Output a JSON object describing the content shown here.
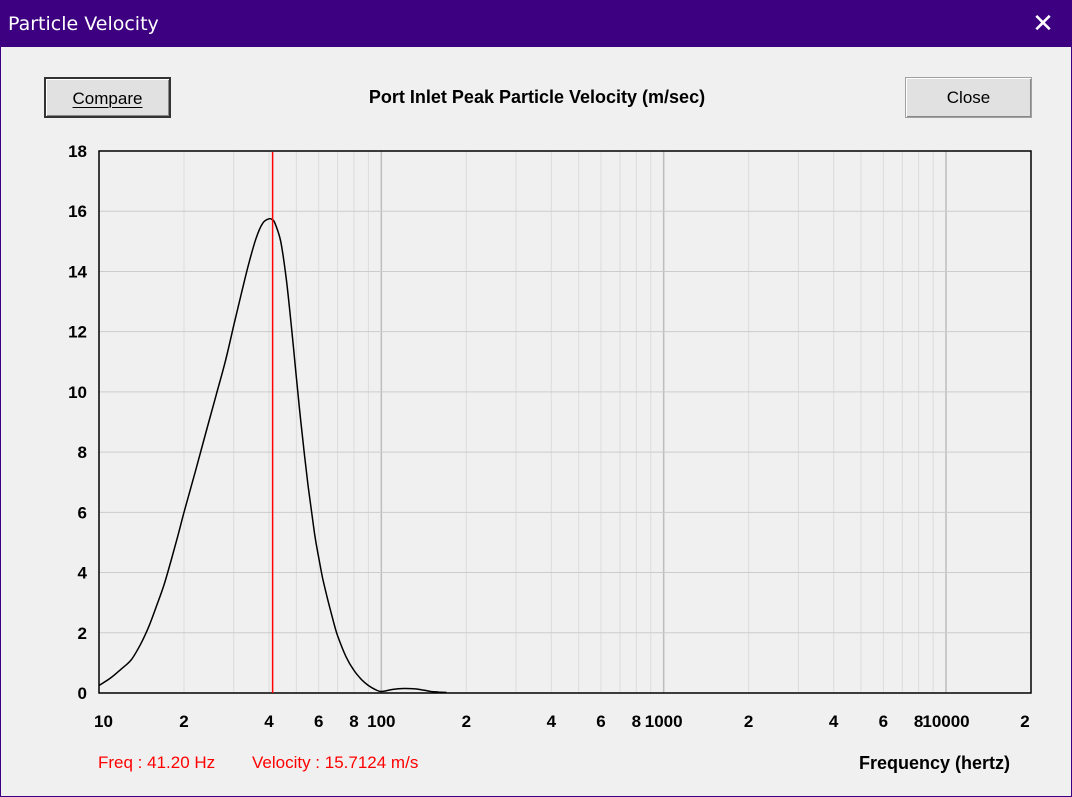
{
  "window": {
    "title": "Particle Velocity",
    "close_glyph": "✕"
  },
  "toolbar": {
    "compare_label": "Compare",
    "close_label": "Close"
  },
  "status": {
    "freq": "Freq : 41.20 Hz",
    "velocity": "Velocity : 15.7124 m/s"
  },
  "colors": {
    "titlebar": "#3d0080",
    "curve": "#000000",
    "cursor": "#ff0000",
    "grid": "#c8c8c8"
  },
  "chart_data": {
    "type": "line",
    "title": "Port Inlet Peak Particle Velocity (m/sec)",
    "xlabel": "Frequency (hertz)",
    "ylabel": "",
    "xscale": "log",
    "xlim": [
      10,
      20000
    ],
    "ylim": [
      0,
      18
    ],
    "grid": true,
    "y_ticks": [
      "0",
      "2",
      "4",
      "6",
      "8",
      "10",
      "12",
      "14",
      "16",
      "18"
    ],
    "x_ticks": [
      {
        "v": 10,
        "label": "10"
      },
      {
        "v": 20,
        "label": "2"
      },
      {
        "v": 40,
        "label": "4"
      },
      {
        "v": 60,
        "label": "6"
      },
      {
        "v": 80,
        "label": "8"
      },
      {
        "v": 100,
        "label": "100"
      },
      {
        "v": 200,
        "label": "2"
      },
      {
        "v": 400,
        "label": "4"
      },
      {
        "v": 600,
        "label": "6"
      },
      {
        "v": 800,
        "label": "8"
      },
      {
        "v": 1000,
        "label": "1000"
      },
      {
        "v": 2000,
        "label": "2"
      },
      {
        "v": 4000,
        "label": "4"
      },
      {
        "v": 6000,
        "label": "6"
      },
      {
        "v": 8000,
        "label": "8"
      },
      {
        "v": 10000,
        "label": "10000"
      },
      {
        "v": 20000,
        "label": "2"
      }
    ],
    "cursor": {
      "x": 41.2,
      "label": "Freq : 41.20 Hz",
      "value": 15.7124
    },
    "series": [
      {
        "x": [
          10,
          11,
          12,
          13,
          14,
          15,
          16,
          17,
          18,
          19,
          20,
          22,
          24,
          26,
          28,
          30,
          32,
          34,
          36,
          38,
          40,
          41.2,
          42,
          44,
          46,
          48,
          50,
          52,
          55,
          58,
          60,
          62,
          65,
          68,
          70,
          75,
          80,
          85,
          90,
          95,
          100,
          110,
          120,
          130,
          140,
          150,
          160,
          170
        ],
        "values": [
          0.25,
          0.5,
          0.8,
          1.1,
          1.6,
          2.2,
          2.9,
          3.6,
          4.4,
          5.2,
          6.0,
          7.4,
          8.7,
          9.9,
          11.0,
          12.2,
          13.3,
          14.3,
          15.1,
          15.6,
          15.75,
          15.7124,
          15.6,
          15.0,
          13.8,
          12.2,
          10.5,
          8.9,
          6.9,
          5.3,
          4.5,
          3.8,
          3.0,
          2.3,
          1.9,
          1.2,
          0.75,
          0.45,
          0.25,
          0.12,
          0.05,
          0.12,
          0.15,
          0.14,
          0.1,
          0.05,
          0.03,
          0.02
        ]
      }
    ]
  }
}
